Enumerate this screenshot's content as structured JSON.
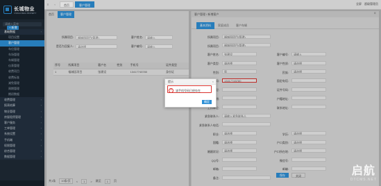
{
  "app": {
    "logo_cn": "长城物业",
    "logo_en": "CHANGCHENG PROPERTY"
  },
  "sidebar": {
    "search_placeholder": "请输入菜单",
    "items": [
      {
        "label": "基础数据",
        "type": "parent",
        "state": "open"
      },
      {
        "label": "项目设置",
        "type": "sub"
      },
      {
        "label": "客户管理",
        "type": "sub",
        "state": "active"
      },
      {
        "label": "车位管理",
        "type": "sub"
      },
      {
        "label": "车场管理",
        "type": "sub"
      },
      {
        "label": "车辆管理",
        "type": "sub"
      },
      {
        "label": "仪表管理",
        "type": "sub"
      },
      {
        "label": "收费项目",
        "type": "sub"
      },
      {
        "label": "收费标准",
        "type": "sub"
      },
      {
        "label": "减免管理",
        "type": "sub"
      },
      {
        "label": "周期管理",
        "type": "sub"
      },
      {
        "label": "期初数据",
        "type": "sub"
      },
      {
        "label": "收费管理",
        "type": "parent"
      },
      {
        "label": "报表结算",
        "type": "parent"
      },
      {
        "label": "物业管理",
        "type": "parent"
      },
      {
        "label": "房屋租赁管理",
        "type": "parent"
      },
      {
        "label": "客户服务",
        "type": "parent"
      },
      {
        "label": "工单管理",
        "type": "parent"
      },
      {
        "label": "系统设置",
        "type": "parent"
      },
      {
        "label": "手机端",
        "type": "parent"
      },
      {
        "label": "权限管理",
        "type": "parent"
      },
      {
        "label": "综合管理",
        "type": "parent"
      },
      {
        "label": "数据管理",
        "type": "parent"
      }
    ]
  },
  "topbar": {
    "tabs": [
      {
        "label": "首页"
      },
      {
        "label": "客户管理",
        "active": true
      }
    ],
    "right": [
      "全屏",
      "超级管理员"
    ]
  },
  "list": {
    "crumbs": [
      "首页",
      "客户管理"
    ],
    "add_label": "+ 新增",
    "filters": {
      "project_label": "所属项目:",
      "project_value": "福城园项目(管理)",
      "name_label": "客户姓名:",
      "name_value": "请输入",
      "type_label": "是否为回复人:",
      "type_value": "请选择",
      "phone_label": "客户编号:",
      "phone_value": "请输入",
      "search_label": "查询"
    },
    "columns": [
      "序号",
      "所属项目",
      "客户名",
      "性别",
      "手机号",
      "证件类型"
    ],
    "rows": [
      [
        "1",
        "福城园项目",
        "张建设",
        "",
        "13417745780",
        "身份证"
      ]
    ],
    "pager": [
      "共1条",
      "10条/页",
      "<",
      "1",
      ">",
      "跳至",
      "1",
      "页"
    ]
  },
  "edit": {
    "head": "客户管理 / 新增客户",
    "tabs": [
      "基本资料",
      "家庭成员",
      "客户车辆"
    ],
    "fields": [
      {
        "label": "所属项目:",
        "value": "福城园项目(管理)"
      },
      {
        "label": "所属项目:",
        "value": "福城园项目(管理)"
      },
      {
        "label": "客户姓名:",
        "value": "张建设",
        "label2": "客户编号:",
        "value2": "请输入"
      },
      {
        "label": "客户类型:",
        "value": "请选择",
        "label2": "客户性质:",
        "value2": "请选择"
      },
      {
        "label": "性别:",
        "value": "男",
        "label2": "民族:",
        "value2": "请选择"
      },
      {
        "label": "手机号码:",
        "value": "13417745780",
        "label2": "固定电话:",
        "value2": ""
      },
      {
        "label": "证件类型:",
        "value": "",
        "label2": "证件号码:",
        "value2": ""
      },
      {
        "label": "出生日期:",
        "value": "",
        "label2": "户籍地址:",
        "value2": ""
      },
      {
        "label": "工作单位:",
        "value": "",
        "label2": "联系地址:",
        "value2": ""
      },
      {
        "label": "紧急联系人:",
        "value": "请输入紧急联系人"
      },
      {
        "label": "紧急联系人电话:",
        "value": ""
      },
      {
        "label": "职业:",
        "value": "请选择",
        "label2": "学历:",
        "value2": "请选择"
      },
      {
        "label": "国籍:",
        "value": "请选择",
        "label2": "户口类别:",
        "value2": "请选择"
      },
      {
        "label": "婚姻状况:",
        "value": "请选择",
        "label2": "户口所在地:",
        "value2": "请选择"
      },
      {
        "label": "QQ号:",
        "value": "",
        "label2": "微信号:",
        "value2": ""
      },
      {
        "label": "邮箱:",
        "value": "",
        "label2": "邮编:",
        "value2": ""
      },
      {
        "label": "备注:",
        "value": ""
      }
    ],
    "save_label": "保存",
    "close_label": "关闭"
  },
  "dialog": {
    "title": "提示",
    "message": "该手机号码已经存在",
    "ok_label": "确定",
    "close_glyph": "×",
    "icon_glyph": "×"
  },
  "watermark": {
    "cn": "启航",
    "en": "DTCMS.NET"
  },
  "colors": {
    "accent": "#2d8fd5",
    "sidebar": "#1f2b36",
    "error": "#d9322d"
  }
}
